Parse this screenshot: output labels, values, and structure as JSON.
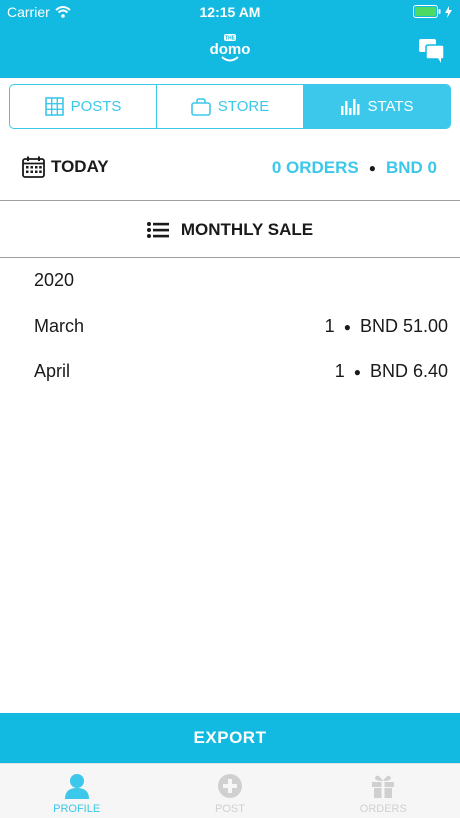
{
  "status_bar": {
    "carrier": "Carrier",
    "time": "12:15 AM"
  },
  "app": {
    "logo_small_text": "THE",
    "logo_text": "domo"
  },
  "segments": [
    {
      "label": "POSTS",
      "icon": "grid-icon",
      "active": false
    },
    {
      "label": "STORE",
      "icon": "bag-icon",
      "active": false
    },
    {
      "label": "STATS",
      "icon": "bar-chart-icon",
      "active": true
    }
  ],
  "today": {
    "label": "TODAY",
    "orders": "0 ORDERS",
    "amount": "BND 0"
  },
  "monthly": {
    "title": "MONTHLY SALE",
    "year": "2020",
    "rows": [
      {
        "month": "March",
        "count": "1",
        "amount": "BND 51.00"
      },
      {
        "month": "April",
        "count": "1",
        "amount": "BND 6.40"
      }
    ]
  },
  "export_label": "EXPORT",
  "tabs": [
    {
      "label": "PROFILE",
      "icon": "person-icon",
      "active": true
    },
    {
      "label": "POST",
      "icon": "plus-circle-icon",
      "active": false
    },
    {
      "label": "ORDERS",
      "icon": "gift-icon",
      "active": false
    }
  ],
  "colors": {
    "brand": "#12b9e0",
    "accent": "#3cc8ea",
    "inactive_tab": "#d0d0d0"
  }
}
